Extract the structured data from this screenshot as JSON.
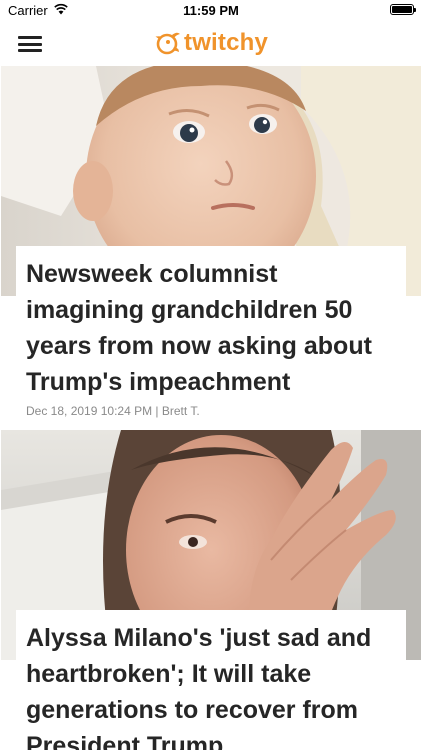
{
  "status_bar": {
    "carrier": "Carrier",
    "time": "11:59 PM",
    "battery_level": 1.0
  },
  "nav": {
    "menu_icon": "hamburger-menu-icon",
    "logo_text": "twitchy",
    "logo_icon": "twitchy-bird-icon",
    "brand_color": "#f0932b"
  },
  "articles": [
    {
      "title": "Newsweek columnist imagining grandchildren 50 years from now asking about Trump's impeachment",
      "meta": "Dec 18, 2019 10:24 PM | Brett T.",
      "image": "baby-photo"
    },
    {
      "title": "Alyssa Milano's 'just sad and heartbroken'; It will take generations to recover from President Trump",
      "image": "woman-wiping-eye-photo"
    }
  ]
}
